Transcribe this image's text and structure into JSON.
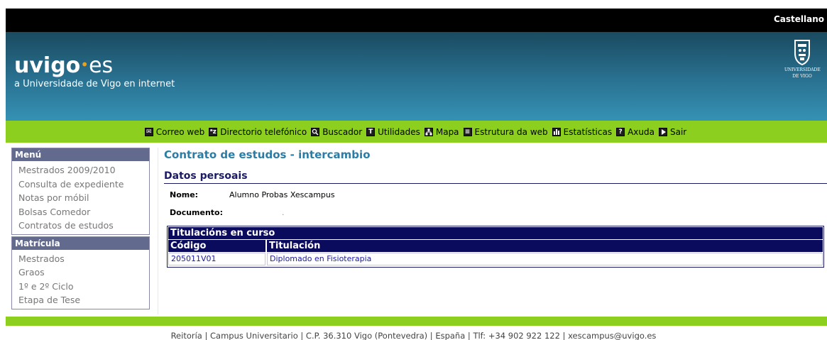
{
  "header": {
    "language_link": "Castellano",
    "logo": {
      "part1": "uvigo",
      "part2": "es"
    },
    "tagline": "a Universidade de Vigo en internet",
    "crest_text_line1": "UNIVERSIDADE",
    "crest_text_line2": "DE VIGO"
  },
  "nav": {
    "items": [
      {
        "label": "Correo web",
        "icon": "mail-icon",
        "glyph": "✉"
      },
      {
        "label": "Directorio telefónico",
        "icon": "phonebook-icon",
        "glyph": "ᵃz"
      },
      {
        "label": "Buscador",
        "icon": "search-icon",
        "glyph": "🔍"
      },
      {
        "label": "Utilidades",
        "icon": "tools-icon",
        "glyph": "T"
      },
      {
        "label": "Mapa",
        "icon": "map-icon",
        "glyph": "品"
      },
      {
        "label": "Estrutura da web",
        "icon": "sitemap-icon",
        "glyph": "≡"
      },
      {
        "label": "Estatísticas",
        "icon": "stats-icon",
        "glyph": "ılı"
      },
      {
        "label": "Axuda",
        "icon": "help-icon",
        "glyph": "?"
      },
      {
        "label": "Sair",
        "icon": "exit-icon",
        "glyph": "▶"
      }
    ]
  },
  "sidebar": {
    "menu": {
      "title": "Menú",
      "items": [
        "Mestrados 2009/2010",
        "Consulta de expediente",
        "Notas por móbil",
        "Bolsas Comedor",
        "Contratos de estudos"
      ]
    },
    "matricula": {
      "title": "Matrícula",
      "items": [
        "Mestrados",
        "Graos",
        "1º e 2º Ciclo",
        "Etapa de Tese"
      ]
    }
  },
  "main": {
    "page_title": "Contrato de estudos - intercambio",
    "section_title": "Datos persoais",
    "fields": {
      "nome_label": "Nome:",
      "nome_value": "Alumno Probas Xescampus",
      "documento_label": "Documento:",
      "documento_value": "."
    },
    "titulacions": {
      "title": "Titulacións en curso",
      "columns": [
        "Código",
        "Titulación"
      ],
      "rows": [
        [
          "205011V01",
          "Diplomado en Fisioterapia"
        ]
      ]
    }
  },
  "footer": {
    "text": "Reitoría | Campus Universitario | C.P. 36.310 Vigo (Pontevedra) | España | Tlf: +34 902 922 122 | xescampus@uvigo.es"
  },
  "colors": {
    "green_bar": "#8ccf1e",
    "banner_blue": "#2a7292",
    "menu_header": "#626a8e",
    "table_header": "#0b0b5e",
    "title_blue": "#2a7da6"
  }
}
